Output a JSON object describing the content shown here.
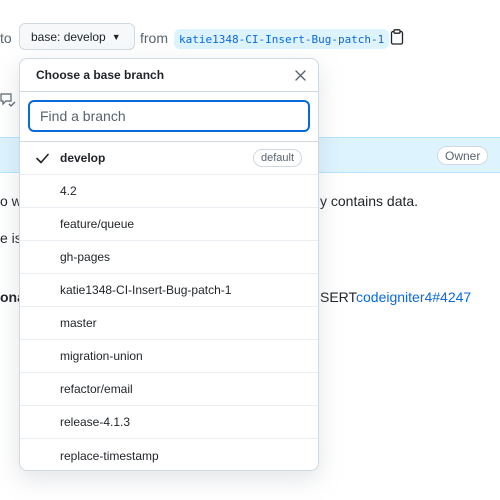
{
  "compare_bar": {
    "into_label": "to",
    "base_button_label": "base: develop",
    "from_label": "from",
    "head_branch": "katie1348-CI-Insert-Bug-patch-1"
  },
  "background": {
    "owner_badge": "Owner",
    "line1_left": "o w",
    "line1_right": "y contains data.",
    "line2_left": "e is",
    "line3_left": "ona",
    "line3_right": "SERT",
    "line3_link": "codeigniter4#4247"
  },
  "dropdown": {
    "title": "Choose a base branch",
    "search_placeholder": "Find a branch",
    "default_badge": "default",
    "branches": [
      {
        "name": "develop",
        "selected": true,
        "default": true
      },
      {
        "name": "4.2",
        "selected": false,
        "default": false
      },
      {
        "name": "feature/queue",
        "selected": false,
        "default": false
      },
      {
        "name": "gh-pages",
        "selected": false,
        "default": false
      },
      {
        "name": "katie1348-CI-Insert-Bug-patch-1",
        "selected": false,
        "default": false
      },
      {
        "name": "master",
        "selected": false,
        "default": false
      },
      {
        "name": "migration-union",
        "selected": false,
        "default": false
      },
      {
        "name": "refactor/email",
        "selected": false,
        "default": false
      },
      {
        "name": "release-4.1.3",
        "selected": false,
        "default": false
      },
      {
        "name": "replace-timestamp",
        "selected": false,
        "default": false
      }
    ]
  },
  "colors": {
    "accent": "#0969da",
    "chip_bg": "#ddf4ff",
    "border": "#d1d9e0",
    "muted": "#59636e"
  }
}
